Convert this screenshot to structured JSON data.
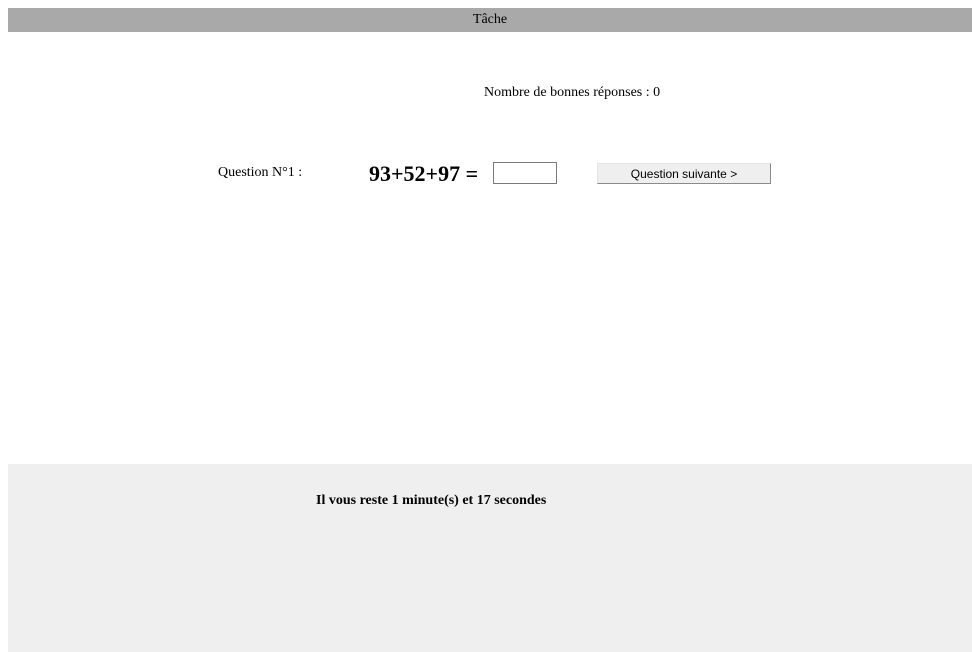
{
  "header": {
    "title": "Tâche"
  },
  "score": {
    "text": "Nombre de bonnes réponses : 0"
  },
  "question": {
    "label": "Question N°1 :",
    "equation": "93+52+97 =",
    "answer_value": "",
    "next_label": "Question suivante >"
  },
  "footer": {
    "timer_text": "Il vous reste 1 minute(s) et 17 secondes"
  },
  "colors": {
    "title_bar": "#a9a9a9",
    "footer_bg": "#efefef",
    "button_bg": "#efefef"
  }
}
